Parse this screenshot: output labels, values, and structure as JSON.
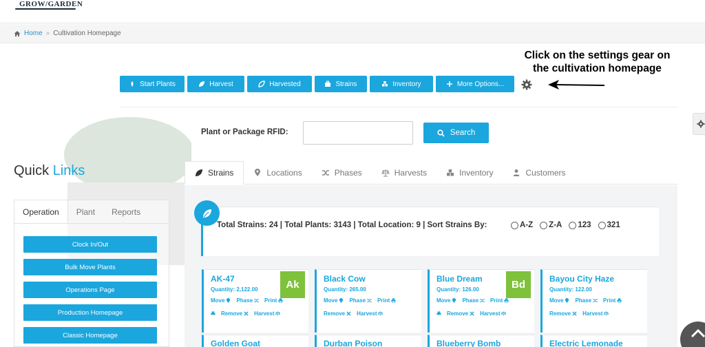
{
  "logo": {
    "text": "GROW/GARDEN"
  },
  "breadcrumb": {
    "home": "Home",
    "separator": "»",
    "current": "Cultivation Homepage"
  },
  "annotation": {
    "line1": "Click on the settings gear on",
    "line2": "the cultivation homepage"
  },
  "toolbar": {
    "buttons": [
      {
        "label": "Start Plants",
        "icon": "seedling-icon"
      },
      {
        "label": "Harvest",
        "icon": "leaf-icon"
      },
      {
        "label": "Harvested",
        "icon": "leaf-outline-icon"
      },
      {
        "label": "Strains",
        "icon": "briefcase-icon"
      },
      {
        "label": "Inventory",
        "icon": "cubes-icon"
      },
      {
        "label": "More Options...",
        "icon": "plus-icon"
      }
    ],
    "settings_icon": "gear-icon"
  },
  "search": {
    "label": "Plant or Package RFID:",
    "value": "",
    "button_label": "Search"
  },
  "quick_links": {
    "title_part1": "Quick ",
    "title_part2": "Links",
    "tabs": [
      "Operation",
      "Plant",
      "Reports"
    ],
    "buttons": [
      "Clock In/Out",
      "Bulk Move Plants",
      "Operations Page",
      "Production Homepage",
      "Classic Homepage"
    ]
  },
  "main_tabs": [
    {
      "label": "Strains",
      "icon": "leaf-icon"
    },
    {
      "label": "Locations",
      "icon": "map-marker-icon"
    },
    {
      "label": "Phases",
      "icon": "shuffle-icon"
    },
    {
      "label": "Harvests",
      "icon": "scale-icon"
    },
    {
      "label": "Inventory",
      "icon": "cubes-icon"
    },
    {
      "label": "Customers",
      "icon": "user-icon"
    }
  ],
  "summary": {
    "text": "Total Strains: 24 | Total Plants: 3143 | Total Location: 9 | Sort Strains By:",
    "sort_options": [
      "A-Z",
      "Z-A",
      "123",
      "321"
    ]
  },
  "card_actions": {
    "move": "Move",
    "phase": "Phase",
    "print": "Print",
    "remove": "Remove",
    "harvest": "Harvest"
  },
  "strains": [
    {
      "name": "AK-47",
      "quantity": "Quantity: 2,122.00",
      "badge": "Ak"
    },
    {
      "name": "Black Cow",
      "quantity": "Quantity: 265.00",
      "badge": ""
    },
    {
      "name": "Blue Dream",
      "quantity": "Quantity: 126.00",
      "badge": "Bd"
    },
    {
      "name": "Bayou City Haze",
      "quantity": "Quantity: 122.00",
      "badge": ""
    }
  ],
  "strains_row2": [
    "Golden Goat",
    "Durban Poison",
    "Blueberry Bomb",
    "Electric Lemonade"
  ],
  "colors": {
    "accent": "#1ba6dd",
    "badge_green": "#7ec13b"
  }
}
